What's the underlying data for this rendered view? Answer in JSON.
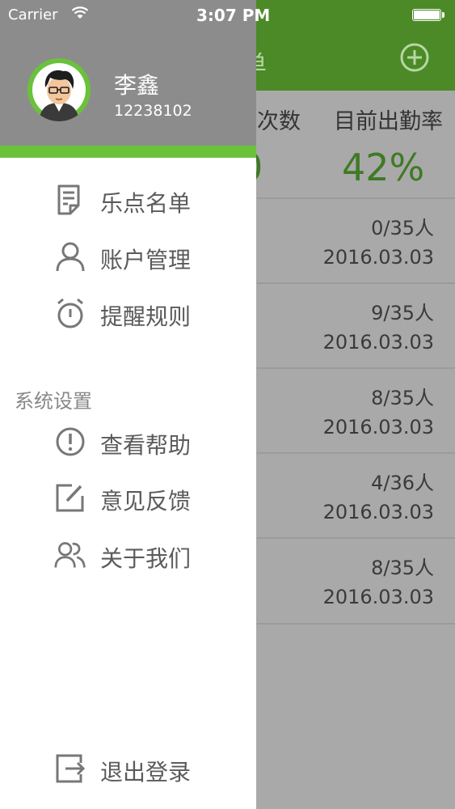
{
  "status_bar": {
    "carrier": "Carrier",
    "time": "3:07 PM"
  },
  "background_screen": {
    "title_partial": "单",
    "col_count_partial": "次数",
    "col_rate": "目前出勤率",
    "rate_value": "42%",
    "count_value_partial": "0",
    "rows": [
      {
        "attendance": "0/35人",
        "date": "2016.03.03"
      },
      {
        "attendance": "9/35人",
        "date": "2016.03.03"
      },
      {
        "attendance": "8/35人",
        "date": "2016.03.03"
      },
      {
        "attendance": "4/36人",
        "date": "2016.03.03"
      },
      {
        "attendance": "8/35人",
        "date": "2016.03.03"
      }
    ]
  },
  "drawer": {
    "user": {
      "name": "李鑫",
      "id": "12238102"
    },
    "menu": [
      {
        "label": "乐点名单",
        "icon": "document-list-icon"
      },
      {
        "label": "账户管理",
        "icon": "person-icon"
      },
      {
        "label": "提醒规则",
        "icon": "alarm-clock-icon"
      }
    ],
    "settings_section_label": "系统设置",
    "settings": [
      {
        "label": "查看帮助",
        "icon": "info-circle-icon"
      },
      {
        "label": "意见反馈",
        "icon": "edit-icon"
      },
      {
        "label": "关于我们",
        "icon": "people-icon"
      }
    ],
    "logout_label": "退出登录",
    "logout_icon": "logout-icon"
  },
  "colors": {
    "accent_green": "#6ac23b",
    "header_gray": "#8c8c8c",
    "app_green": "#4b8a27"
  }
}
